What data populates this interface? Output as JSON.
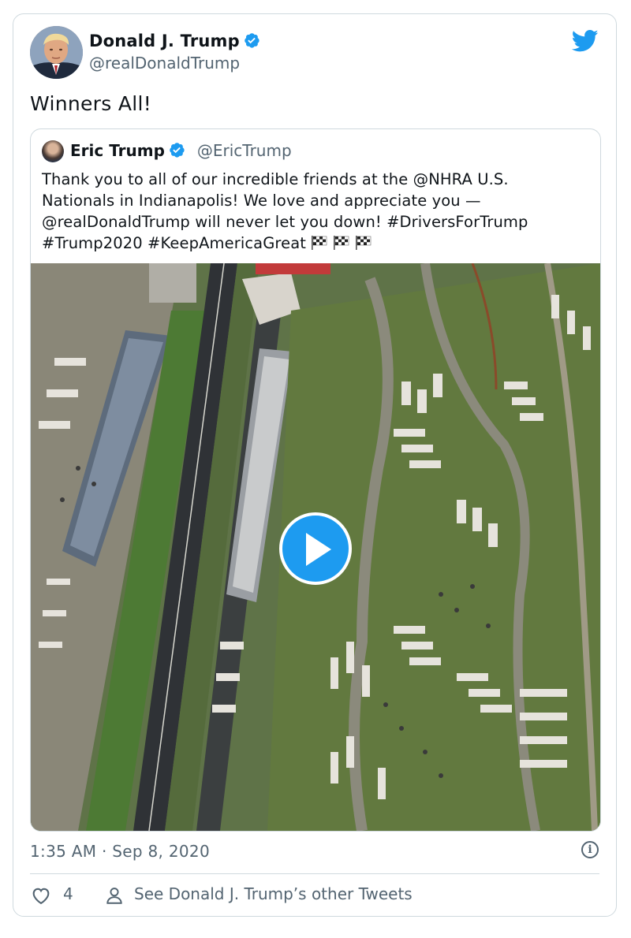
{
  "tweet": {
    "author_name": "Donald J. Trump",
    "author_handle": "@realDonaldTrump",
    "text": "Winners All!",
    "timestamp": "1:35 AM · Sep 8, 2020",
    "like_count": "4",
    "other_tweets_link": "See Donald J. Trump’s other Tweets"
  },
  "quoted_tweet": {
    "author_name": "Eric Trump",
    "author_handle": "@EricTrump",
    "text_lines": [
      "Thank you to all of our incredible friends at the @NHRA U.S.",
      "Nationals in Indianapolis! We love and appreciate you —",
      "@realDonaldTrump will never let you down! #DriversForTrump",
      "#Trump2020 #KeepAmericaGreat"
    ],
    "emojis": [
      "chequered-flag",
      "chequered-flag",
      "chequered-flag"
    ],
    "media": {
      "type": "video",
      "description_icon": "play-icon"
    }
  },
  "icons": {
    "brand": "twitter-bird-icon",
    "verified": "verified-badge-icon",
    "info": "info-icon",
    "like": "heart-icon",
    "profile": "person-icon"
  },
  "colors": {
    "accent": "#1d9bf0",
    "text": "#0f1419",
    "secondary_text": "#536471",
    "border": "#cfd9de"
  }
}
